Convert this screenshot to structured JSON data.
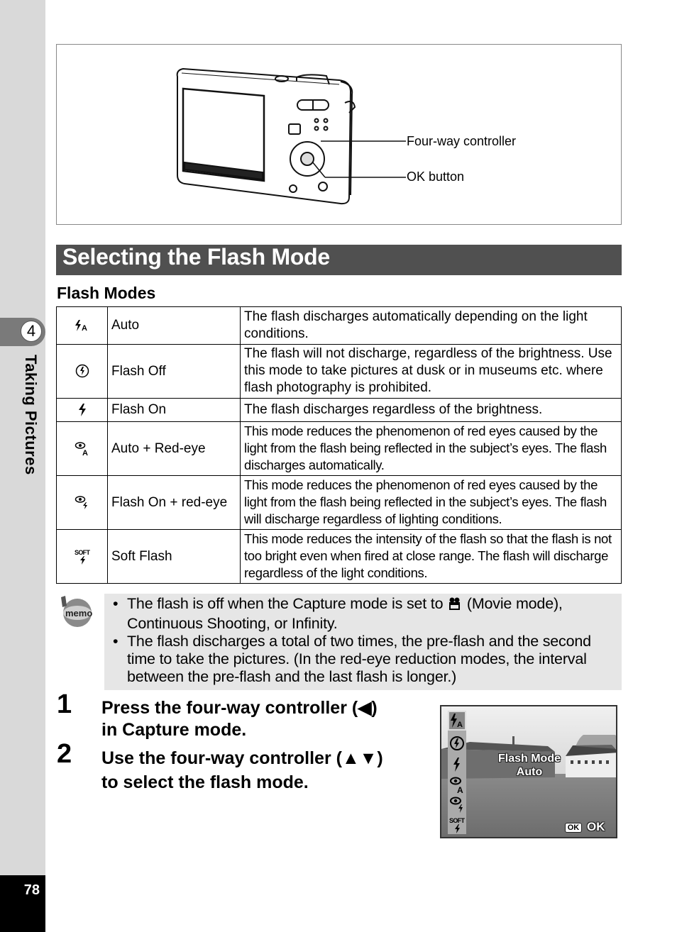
{
  "sidebar": {
    "chapter_number": "4",
    "chapter_title": "Taking Pictures",
    "page_number": "78"
  },
  "illustration": {
    "callouts": [
      "Four-way controller",
      "OK button"
    ]
  },
  "section": {
    "title": "Selecting the Flash Mode",
    "subtitle": "Flash Modes"
  },
  "flash_modes": [
    {
      "icon": "flash-auto-icon",
      "name": "Auto",
      "description": "The flash discharges automatically depending on the light conditions."
    },
    {
      "icon": "flash-off-icon",
      "name": "Flash Off",
      "description": "The flash will not discharge, regardless of the brightness. Use this mode to take pictures at dusk or in museums etc. where flash photography is prohibited."
    },
    {
      "icon": "flash-on-icon",
      "name": "Flash On",
      "description": "The flash discharges regardless of the brightness."
    },
    {
      "icon": "auto-red-eye-icon",
      "name": "Auto + Red-eye",
      "description": "This mode reduces the phenomenon of red eyes caused by the light from the flash being reflected in the subject’s eyes. The flash discharges automatically."
    },
    {
      "icon": "flash-on-red-eye-icon",
      "name": "Flash On + red-eye",
      "description": "This mode reduces the phenomenon of red eyes caused by the light from the flash being reflected in the subject’s eyes. The flash will discharge regardless of lighting conditions."
    },
    {
      "icon": "soft-flash-icon",
      "name": "Soft Flash",
      "description": "This mode reduces the intensity of the flash so that the flash is not too bright even when fired at close range. The flash will discharge regardless of the light conditions."
    }
  ],
  "memo": {
    "icon_label": "memo",
    "items": [
      {
        "before": "The flash is off when the Capture mode is set to ",
        "icon": "movie-mode-icon",
        "after": " (Movie mode), Continuous Shooting, or Infinity."
      },
      {
        "text": "The flash discharges a total of two times, the pre-flash and the second time to take the pictures. (In the red-eye reduction modes, the interval between the pre-flash and the last flash is longer.)"
      }
    ]
  },
  "steps": [
    {
      "number": "1",
      "line1": "Press the four-way controller (◀)",
      "line2": "in Capture mode."
    },
    {
      "number": "2",
      "line1": "Use the four-way controller (▲▼)",
      "line2": "to select the flash mode."
    }
  ],
  "lcd_screen": {
    "menu_title": "Flash Mode",
    "selected_value": "Auto",
    "selected_index": 0,
    "menu_icons": [
      "flash-auto-icon",
      "flash-off-icon",
      "flash-on-icon",
      "auto-red-eye-icon",
      "flash-on-red-eye-icon",
      "soft-flash-icon"
    ],
    "ok_key": "OK",
    "ok_label": "OK"
  }
}
